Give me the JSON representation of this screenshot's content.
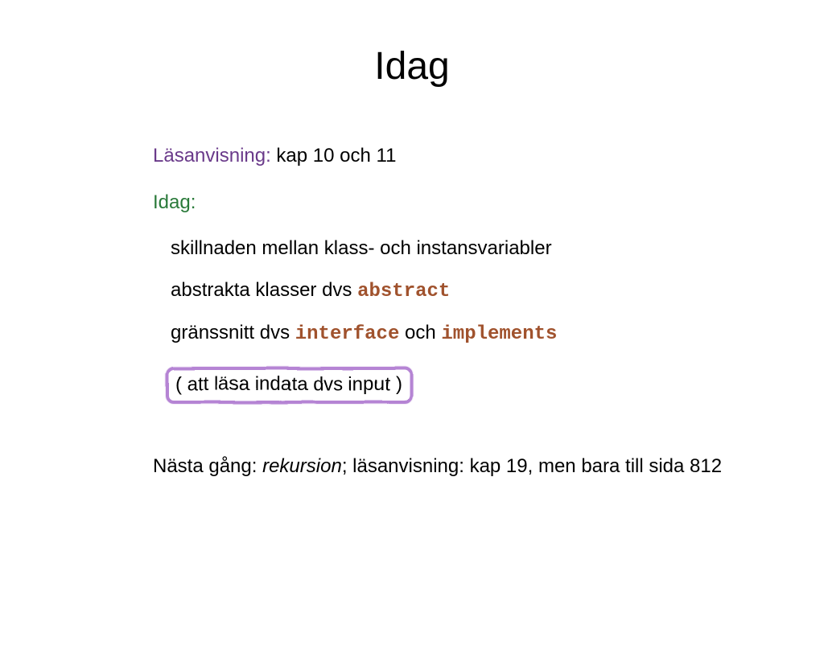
{
  "title": "Idag",
  "lines": {
    "reading_label": "Läsanvisning:",
    "reading_text": "  kap 10 och 11",
    "idag_label": "Idag:",
    "bullet1": "skillnaden mellan klass- och instansvariabler",
    "bullet2_pre": "abstrakta klasser dvs ",
    "bullet2_code": "abstract",
    "bullet3_pre": "gränssnitt dvs ",
    "bullet3_code1": "interface",
    "bullet3_mid": " och ",
    "bullet3_code2": "implements",
    "bullet4": "( att läsa indata dvs input )",
    "next_pre": "Nästa gång: ",
    "next_italic": "rekursion",
    "next_post": "; läsanvisning: kap 19, men bara till sida 812"
  }
}
